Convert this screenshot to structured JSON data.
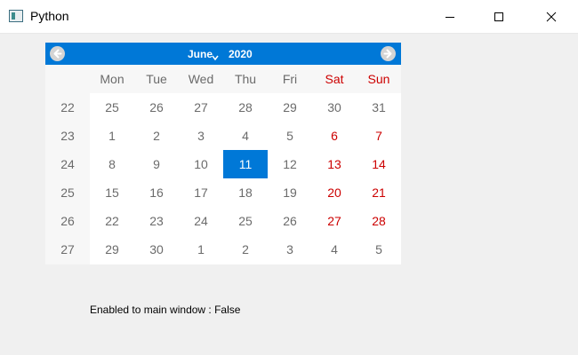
{
  "window": {
    "title": "Python"
  },
  "calendar": {
    "month": "June",
    "year": "2020",
    "day_headers": [
      "Mon",
      "Tue",
      "Wed",
      "Thu",
      "Fri",
      "Sat",
      "Sun"
    ],
    "week_numbers": [
      "22",
      "23",
      "24",
      "25",
      "26",
      "27"
    ],
    "rows": [
      [
        "25",
        "26",
        "27",
        "28",
        "29",
        "30",
        "31"
      ],
      [
        "1",
        "2",
        "3",
        "4",
        "5",
        "6",
        "7"
      ],
      [
        "8",
        "9",
        "10",
        "11",
        "12",
        "13",
        "14"
      ],
      [
        "15",
        "16",
        "17",
        "18",
        "19",
        "20",
        "21"
      ],
      [
        "22",
        "23",
        "24",
        "25",
        "26",
        "27",
        "28"
      ],
      [
        "29",
        "30",
        "1",
        "2",
        "3",
        "4",
        "5"
      ]
    ],
    "selected_day": "11",
    "weekend_color": "#cc0000",
    "accent_color": "#0078d7"
  },
  "status": {
    "text": "Enabled to main window : False"
  }
}
